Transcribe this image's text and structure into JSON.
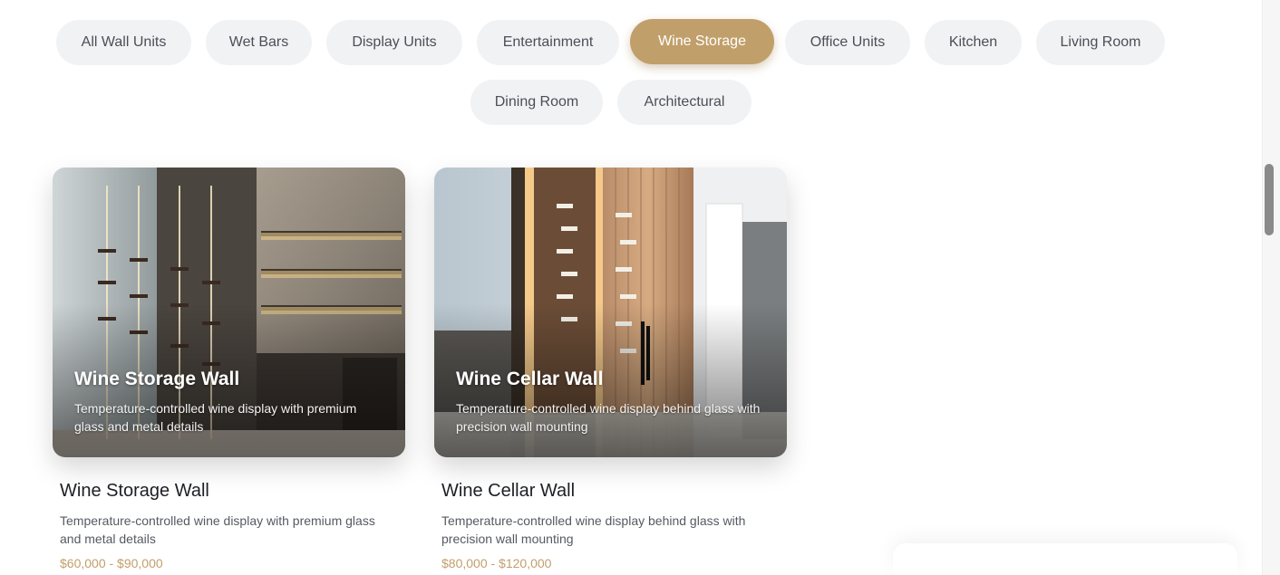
{
  "filters": [
    {
      "label": "All Wall Units",
      "active": false
    },
    {
      "label": "Wet Bars",
      "active": false
    },
    {
      "label": "Display Units",
      "active": false
    },
    {
      "label": "Entertainment",
      "active": false
    },
    {
      "label": "Wine Storage",
      "active": true
    },
    {
      "label": "Office Units",
      "active": false
    },
    {
      "label": "Kitchen",
      "active": false
    },
    {
      "label": "Living Room",
      "active": false
    },
    {
      "label": "Dining Room",
      "active": false
    },
    {
      "label": "Architectural",
      "active": false
    }
  ],
  "products": [
    {
      "title": "Wine Storage Wall",
      "description": "Temperature-controlled wine display with premium glass and metal details",
      "price": "$60,000 - $90,000"
    },
    {
      "title": "Wine Cellar Wall",
      "description": "Temperature-controlled wine display behind glass with precision wall mounting",
      "price": "$80,000 - $120,000"
    }
  ],
  "colors": {
    "accent": "#c19f6a",
    "chip_bg": "#f1f2f4"
  }
}
